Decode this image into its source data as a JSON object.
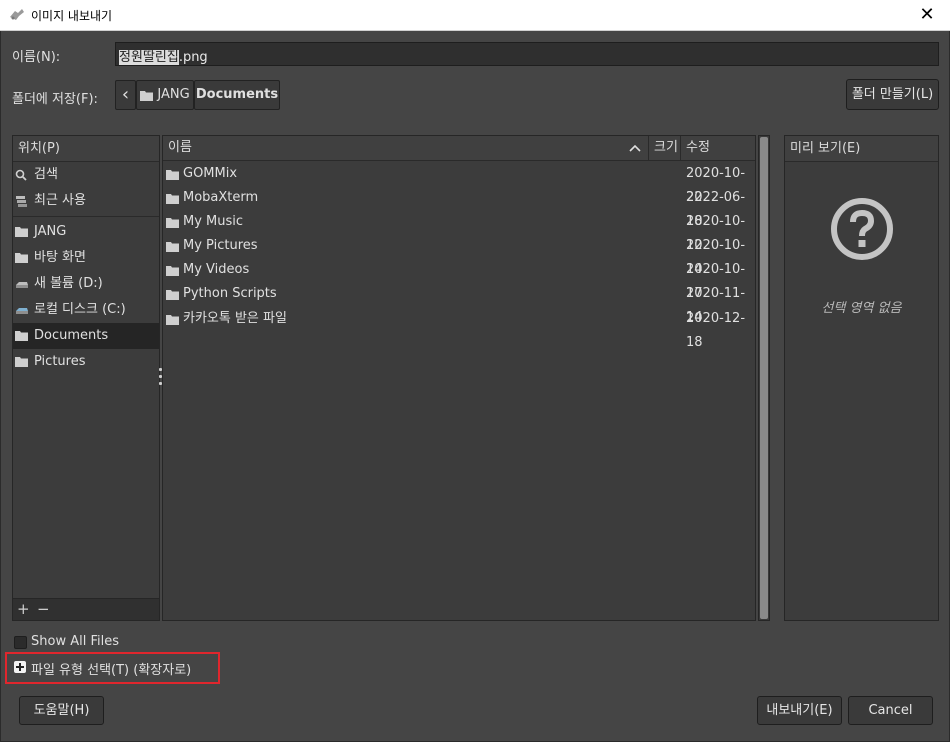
{
  "window": {
    "title": "이미지 내보내기",
    "close_glyph": "✕"
  },
  "name_field": {
    "label": "이름(N):",
    "selected_part": "정원딸린집",
    "extension": ".png"
  },
  "save_in": {
    "label": "폴더에 저장(F):",
    "back_glyph": "‹",
    "crumbs": [
      "JANG",
      "Documents"
    ]
  },
  "create_folder_button": "폴더 만들기(L)",
  "places": {
    "header": "위치(P)",
    "items": [
      {
        "label": "검색",
        "icon": "search-icon"
      },
      {
        "label": "최근 사용",
        "icon": "recent-icon"
      },
      {
        "label": "JANG",
        "icon": "folder-icon"
      },
      {
        "label": "바탕 화면",
        "icon": "folder-icon"
      },
      {
        "label": "새 볼륨 (D:)",
        "icon": "drive-icon"
      },
      {
        "label": "로컬 디스크 (C:)",
        "icon": "drive-icon"
      },
      {
        "label": "Documents",
        "icon": "folder-icon",
        "active": true
      },
      {
        "label": "Pictures",
        "icon": "folder-icon"
      }
    ],
    "add_glyph": "+",
    "remove_glyph": "−"
  },
  "file_list": {
    "columns": {
      "name": "이름",
      "size": "크기",
      "modified": "수정"
    },
    "sort_glyph": "^",
    "rows": [
      {
        "name": "GOMMix",
        "modified": "2020-10-22"
      },
      {
        "name": "MobaXterm",
        "modified": "2022-06-18"
      },
      {
        "name": "My Music",
        "modified": "2020-10-12"
      },
      {
        "name": "My Pictures",
        "modified": "2020-10-14"
      },
      {
        "name": "My Videos",
        "modified": "2020-10-17"
      },
      {
        "name": "Python Scripts",
        "modified": "2020-11-14"
      },
      {
        "name": "카카오톡 받은 파일",
        "modified": "2020-12-18"
      }
    ]
  },
  "preview": {
    "header": "미리 보기(E)",
    "empty_text": "선택 영역 없음"
  },
  "show_all_files": {
    "label": "Show All Files",
    "checked": false
  },
  "file_type_expander": {
    "label": "파일 유형 선택(T) (확장자로)"
  },
  "buttons": {
    "help": "도움말(H)",
    "export": "내보내기(E)",
    "cancel": "Cancel"
  },
  "colors": {
    "background": "#454545",
    "panel": "#3c3c3c",
    "highlight_box": "#e0262d"
  }
}
